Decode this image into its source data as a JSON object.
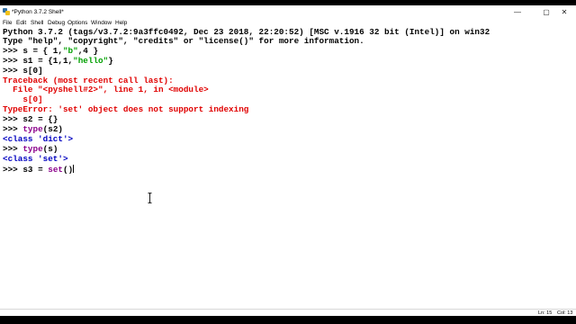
{
  "window": {
    "title": "*Python 3.7.2 Shell*"
  },
  "window_controls": {
    "minimize": "—",
    "maximize": "▢",
    "close": "✕"
  },
  "menu": [
    "File",
    "Edit",
    "Shell",
    "Debug",
    "Options",
    "Window",
    "Help"
  ],
  "shell": {
    "banner1": "Python 3.7.2 (tags/v3.7.2:9a3ffc0492, Dec 23 2018, 22:20:52) [MSC v.1916 32 bit (Intel)] on win32",
    "banner2": "Type \"help\", \"copyright\", \"credits\" or \"license()\" for more information.",
    "prompt": ">>> ",
    "l1_code1": "s = { 1,",
    "l1_str": "\"b\"",
    "l1_code2": ",4 }",
    "l2_code1": "s1 = {1,1,",
    "l2_str": "\"hello\"",
    "l2_code2": "}",
    "l3_code": "s[0]",
    "tb1": "Traceback (most recent call last):",
    "tb2": "  File \"<pyshell#2>\", line 1, in <module>",
    "tb3": "    s[0]",
    "tb4": "TypeError: 'set' object does not support indexing",
    "l4_code": "s2 = {}",
    "l5_builtin": "type",
    "l5_code": "(s2)",
    "out1": "<class 'dict'>",
    "l6_builtin": "type",
    "l6_code": "(s)",
    "out2": "<class 'set'>",
    "l7_code": "s3 = ",
    "l7_builtin": "set",
    "l7_code2": "()"
  },
  "status": {
    "line": "Ln: 15",
    "col": "Col: 13"
  }
}
